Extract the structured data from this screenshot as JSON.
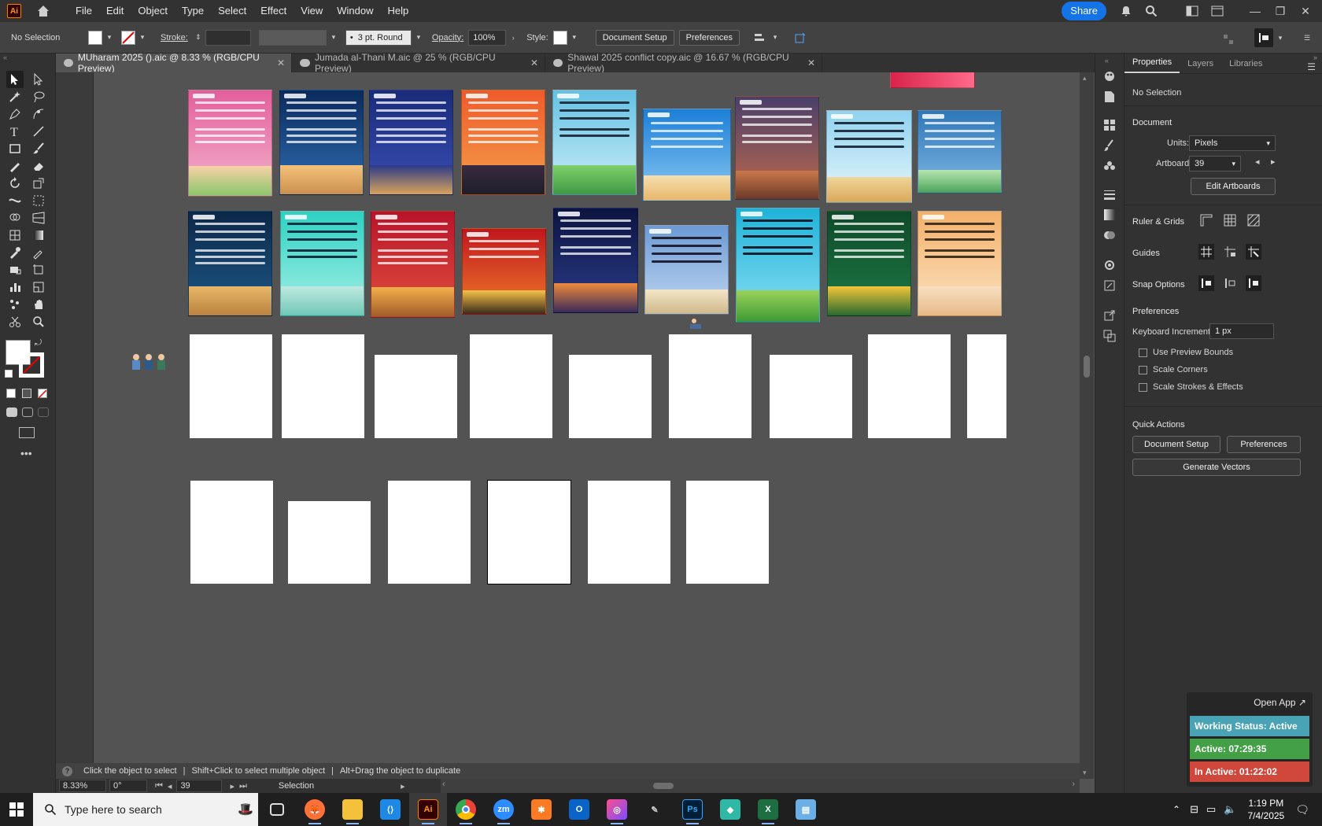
{
  "menubar": {
    "items": [
      "File",
      "Edit",
      "Object",
      "Type",
      "Select",
      "Effect",
      "View",
      "Window",
      "Help"
    ],
    "share_label": "Share"
  },
  "control": {
    "selection": "No Selection",
    "stroke_label": "Stroke:",
    "brush": "3 pt. Round",
    "opacity_label": "Opacity:",
    "opacity_value": "100%",
    "style_label": "Style:",
    "document_setup": "Document Setup",
    "preferences": "Preferences"
  },
  "tabs": [
    {
      "label": "MUharam 2025 ().aic @ 8.33 % (RGB/CPU Preview)",
      "active": true
    },
    {
      "label": "Jumada al-Thani M.aic @ 25 % (RGB/CPU Preview)",
      "active": false
    },
    {
      "label": "Shawal 2025 conflict copy.aic @ 16.67 % (RGB/CPU Preview)",
      "active": false
    }
  ],
  "hint": {
    "part1": "Click the object to select",
    "part2": "Shift+Click to select multiple object",
    "part3": "Alt+Drag the object to duplicate"
  },
  "status": {
    "zoom": "8.33%",
    "rotation": "0°",
    "artboard": "39",
    "tool": "Selection"
  },
  "panel": {
    "tabs": [
      "Properties",
      "Layers",
      "Libraries"
    ],
    "no_selection": "No Selection",
    "document_heading": "Document",
    "units_label": "Units:",
    "units_value": "Pixels",
    "artboard_label": "Artboard:",
    "artboard_value": "39",
    "edit_artboards": "Edit Artboards",
    "ruler_grids": "Ruler & Grids",
    "guides": "Guides",
    "snap_options": "Snap Options",
    "preferences_heading": "Preferences",
    "keyboard_increment_label": "Keyboard Increment:",
    "keyboard_increment_value": "1 px",
    "use_preview_bounds": "Use Preview Bounds",
    "scale_corners": "Scale Corners",
    "scale_strokes": "Scale Strokes & Effects",
    "quick_actions": "Quick Actions",
    "document_setup": "Document Setup",
    "preferences_btn": "Preferences",
    "generate_vectors": "Generate Vectors"
  },
  "tracker": {
    "open_app": "Open App ↗",
    "working_status": "Working Status: Active",
    "active_time": "Active: 07:29:35",
    "inactive_time": "In Active: 01:22:02"
  },
  "taskbar": {
    "search_placeholder": "Type here to search",
    "time": "1:19 PM",
    "date": "7/4/2025"
  },
  "colors": {
    "accent": "#1473e6",
    "tracker_status": "#4aa3b5",
    "tracker_active": "#43a047",
    "tracker_inactive": "#d0473c"
  }
}
